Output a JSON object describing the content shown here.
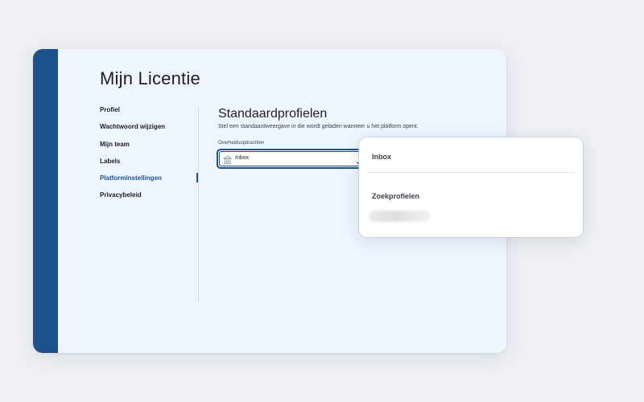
{
  "page": {
    "title": "Mijn Licentie"
  },
  "sidebar": {
    "items": [
      {
        "label": "Profiel",
        "active": false
      },
      {
        "label": "Wachtwoord wijzigen",
        "active": false
      },
      {
        "label": "Mijn team",
        "active": false
      },
      {
        "label": "Labels",
        "active": false
      },
      {
        "label": "Platforminstellingen",
        "active": true
      },
      {
        "label": "Privacybeleid",
        "active": false
      }
    ]
  },
  "main": {
    "section_title": "Standaardprofielen",
    "description": "Stel een standaardweergave in die wordt geladen wanneer u het platform opent.",
    "field": {
      "label": "Overheidsopdrachten",
      "value": "Inbox",
      "icon": "building-icon"
    }
  },
  "dropdown": {
    "option": "Inbox",
    "group_label": "Zoekprofielen"
  },
  "colors": {
    "accent": "#1e5189",
    "window_bg": "#eef5fe",
    "page_bg": "#eef0f4"
  }
}
